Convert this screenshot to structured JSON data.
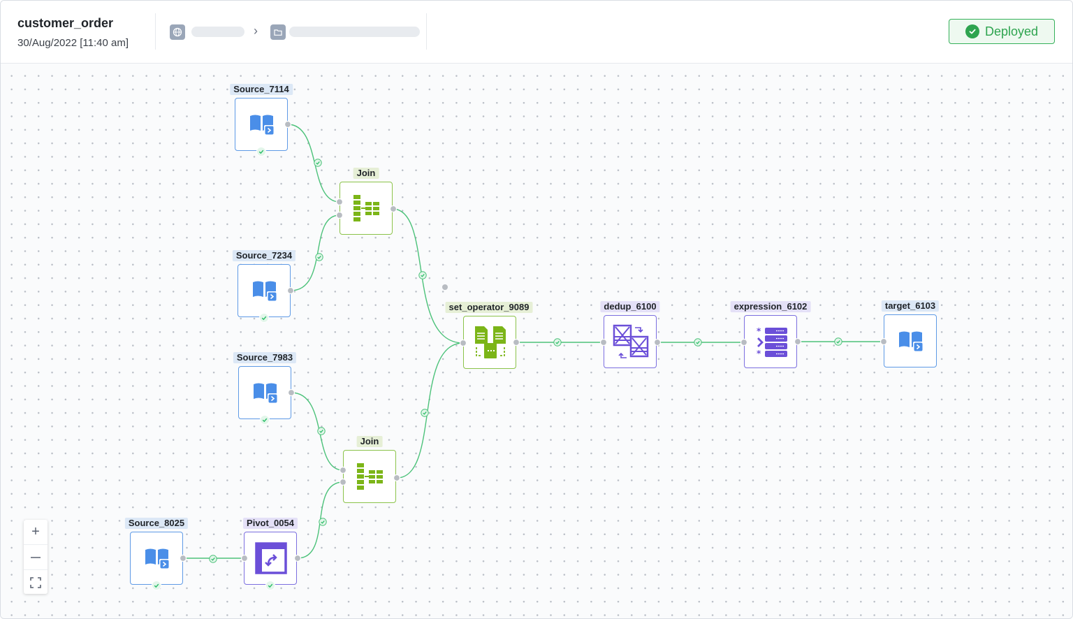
{
  "header": {
    "title": "customer_order",
    "timestamp": "30/Aug/2022 [11:40 am]",
    "breadcrumb": [
      {
        "icon": "globe-icon"
      },
      {
        "icon": "folder-icon"
      }
    ],
    "status": {
      "label": "Deployed",
      "icon": "check-circle-icon",
      "color": "#2ea44f"
    }
  },
  "nodes": [
    {
      "id": "source_7114",
      "label": "Source_7114",
      "type": "source",
      "icon": "book-source-icon",
      "color": "#4a8ee8"
    },
    {
      "id": "source_7234",
      "label": "Source_7234",
      "type": "source",
      "icon": "book-source-icon",
      "color": "#4a8ee8"
    },
    {
      "id": "source_7983",
      "label": "Source_7983",
      "type": "source",
      "icon": "book-source-icon",
      "color": "#4a8ee8"
    },
    {
      "id": "source_8025",
      "label": "Source_8025",
      "type": "source",
      "icon": "book-source-icon",
      "color": "#4a8ee8"
    },
    {
      "id": "join_1",
      "label": "Join",
      "type": "join",
      "icon": "join-icon",
      "color": "#7cb518"
    },
    {
      "id": "join_2",
      "label": "Join",
      "type": "join",
      "icon": "join-icon",
      "color": "#7cb518"
    },
    {
      "id": "pivot_0054",
      "label": "Pivot_0054",
      "type": "pivot",
      "icon": "pivot-icon",
      "color": "#6b4fd8"
    },
    {
      "id": "set_operator_9089",
      "label": "set_operator_9089",
      "type": "set_operator",
      "icon": "set-operator-icon",
      "color": "#7cb518"
    },
    {
      "id": "dedup_6100",
      "label": "dedup_6100",
      "type": "dedup",
      "icon": "dedup-icon",
      "color": "#6b4fd8"
    },
    {
      "id": "expression_6102",
      "label": "expression_6102",
      "type": "expression",
      "icon": "expression-icon",
      "color": "#6b4fd8"
    },
    {
      "id": "target_6103",
      "label": "target_6103",
      "type": "target",
      "icon": "book-target-icon",
      "color": "#4a8ee8"
    }
  ],
  "edges": [
    {
      "from": "source_7114",
      "to": "join_1"
    },
    {
      "from": "source_7234",
      "to": "join_1"
    },
    {
      "from": "join_1",
      "to": "set_operator_9089"
    },
    {
      "from": "source_7983",
      "to": "join_2"
    },
    {
      "from": "pivot_0054",
      "to": "join_2"
    },
    {
      "from": "join_2",
      "to": "set_operator_9089"
    },
    {
      "from": "source_8025",
      "to": "pivot_0054"
    },
    {
      "from": "set_operator_9089",
      "to": "dedup_6100"
    },
    {
      "from": "dedup_6100",
      "to": "expression_6102"
    },
    {
      "from": "expression_6102",
      "to": "target_6103"
    }
  ],
  "zoom_controls": [
    {
      "name": "zoom-in-button",
      "glyph": "+"
    },
    {
      "name": "zoom-out-button",
      "glyph": "—"
    },
    {
      "name": "fit-view-button",
      "glyph": "⛶"
    }
  ],
  "colors": {
    "edge": "#4cc27a",
    "valid": "#2fbf6b",
    "port": "#b8bcc2"
  }
}
